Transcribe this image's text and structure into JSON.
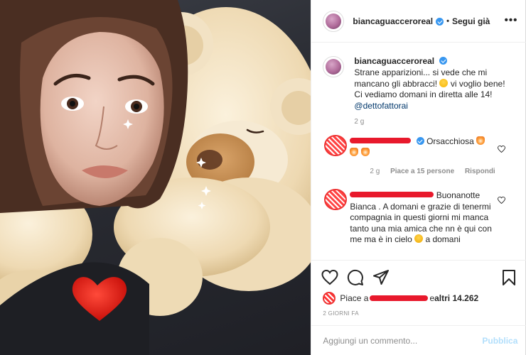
{
  "header": {
    "username": "biancaguaccero real",
    "username_display": "biancaguacceroreal",
    "separator": "•",
    "follow_label": "Segui già",
    "more_label": "•••"
  },
  "caption": {
    "username": "biancaguacceroreal",
    "text_part1": "Strane apparizioni... si vede che mi mancano gli abbracci! ",
    "text_part2": " vi voglio bene! Ci vediamo domani in diretta alle 14! ",
    "mention": "@dettofattorai",
    "time": "2 g"
  },
  "comments": [
    {
      "text": "Orsacchiosa",
      "time": "2 g",
      "likes": "Piace a 15 persone",
      "reply": "Rispondi"
    },
    {
      "text_start": "Buonanotte",
      "text_rest": "Bianca . A domani e grazie di tenermi compagnia in questi giorni mi manca tanto una mia amica che nn è qui con me ma è in cielo ",
      "text_end": " a domani"
    }
  ],
  "actions": {
    "icons": [
      "heart-icon",
      "comment-icon",
      "share-icon",
      "bookmark-icon"
    ],
    "likes_prefix": "Piace a ",
    "likes_joiner": " e ",
    "likes_rest": "altri 14.262",
    "posted": "2 GIORNI FA"
  },
  "composer": {
    "placeholder": "Aggiungi un commento...",
    "publish_label": "Pubblica"
  },
  "colors": {
    "link": "#00376b",
    "verified": "#3897f0",
    "publish_disabled": "#b2dffc",
    "muted": "#8e8e8e"
  }
}
